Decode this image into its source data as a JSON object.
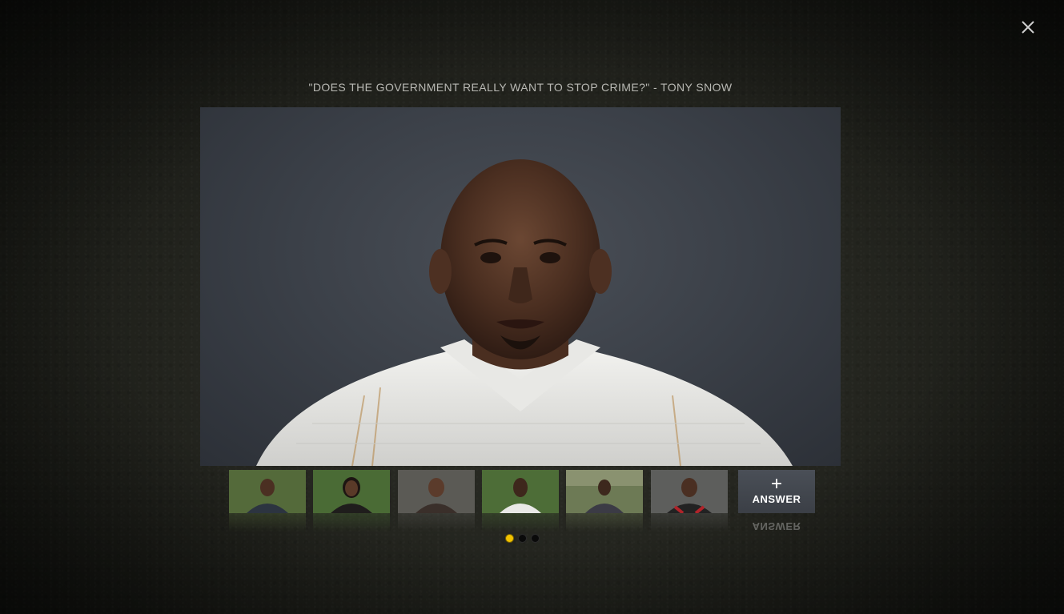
{
  "modal": {
    "title": "\"DOES THE GOVERNMENT REALLY WANT TO STOP CRIME?\" - TONY SNOW",
    "close_icon": "close-icon"
  },
  "thumbnails": [
    {
      "background": "#546a3a",
      "shirt": "#2c3440"
    },
    {
      "background": "#4a6b35",
      "shirt": "#1f1d1c"
    },
    {
      "background": "#5b5a55",
      "shirt": "#3a2f2a"
    },
    {
      "background": "#4d6d37",
      "shirt": "#e9e9e6"
    },
    {
      "background": "#6d7a55",
      "shirt": "#3b3b45"
    },
    {
      "background": "#5d5e5c",
      "shirt": "#222222"
    }
  ],
  "answer": {
    "icon": "plus-icon",
    "label": "ANSWER",
    "reflection": "ANSWER"
  },
  "pagination": {
    "pages": 3,
    "active": 1
  },
  "colors": {
    "accent": "#f2c300",
    "background": "#24251f"
  }
}
